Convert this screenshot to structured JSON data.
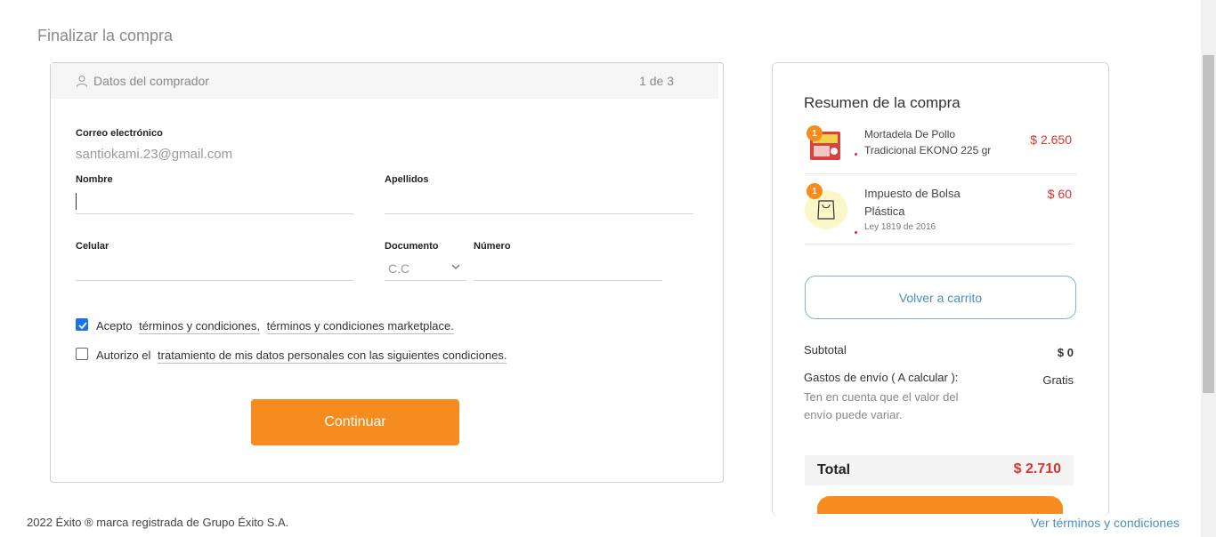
{
  "page": {
    "title": "Finalizar la compra"
  },
  "form": {
    "header_title": "Datos del comprador",
    "step": "1 de 3",
    "email_label": "Correo electrónico",
    "email_value": "santiokami.23@gmail.com",
    "nombre_label": "Nombre",
    "apellidos_label": "Apellidos",
    "celular_label": "Celular",
    "documento_label": "Documento",
    "documento_value": "C.C",
    "numero_label": "Número",
    "terms": {
      "prefix": "Acepto",
      "link1": "términos y condiciones,",
      "link2": "términos y condiciones marketplace.",
      "checked": true
    },
    "privacy": {
      "prefix": "Autorizo el",
      "link": "tratamiento de mis datos personales con las siguientes condiciones.",
      "checked": false
    },
    "continue_label": "Continuar"
  },
  "summary": {
    "title": "Resumen de la compra",
    "items": [
      {
        "qty": "1",
        "name_line1": "Mortadela De Pollo",
        "name_line2": "Tradicional EKONO 225 gr",
        "price": "$ 2.650"
      },
      {
        "qty": "1",
        "name_line1": "Impuesto de Bolsa",
        "name_line2": "Plástica",
        "sub": "Ley 1819 de 2016",
        "price": "$ 60"
      }
    ],
    "back_label": "Volver a carrito",
    "subtotal_label": "Subtotal",
    "subtotal_value": "$ 0",
    "shipping_label": "Gastos de envío ( A calcular ):",
    "shipping_value": "Gratis",
    "shipping_note_1": "Ten en cuenta que el valor del",
    "shipping_note_2": "envío puede variar.",
    "total_label": "Total",
    "total_value": "$ 2.710"
  },
  "footer": {
    "copyright": "2022 Éxito ® marca registrada de Grupo Éxito S.A.",
    "terms_link": "Ver términos y condiciones"
  },
  "colors": {
    "accent": "#f68b1f",
    "price_red": "#e0322f",
    "link_blue": "#4a90c2",
    "checkbox_blue": "#1a73e8"
  },
  "icons": {
    "header": "user-icon",
    "select": "chevron-down-icon",
    "bag": "shopping-bag-icon"
  }
}
